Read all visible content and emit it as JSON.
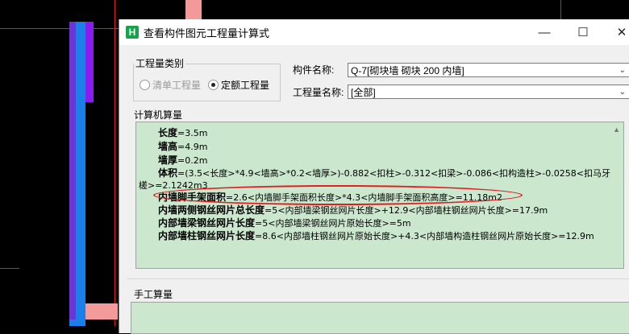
{
  "dialog": {
    "title": "查看构件图元工程量计算式",
    "app_icon_letter": "H"
  },
  "quantity_type": {
    "group_label": "工程量类别",
    "options": [
      {
        "label": "清单工程量",
        "checked": false,
        "disabled": true
      },
      {
        "label": "定额工程量",
        "checked": true,
        "disabled": false
      }
    ]
  },
  "component": {
    "name_label": "构件名称:",
    "name_value": "Q-7[砌块墙 砌块 200 内墙]",
    "qty_label": "工程量名称:",
    "qty_value": "[全部]"
  },
  "computer_calc": {
    "section_label": "计算机算量",
    "lines": [
      {
        "term": "长度",
        "formula": "=3.5m"
      },
      {
        "term": "墙高",
        "formula": "=4.9m"
      },
      {
        "term": "墙厚",
        "formula": "=0.2m"
      },
      {
        "term": "体积",
        "formula": "=(3.5<长度>*4.9<墙高>*0.2<墙厚>)-0.882<扣柱>-0.312<扣梁>-0.086<扣构造柱>-0.0258<扣马牙"
      },
      {
        "term": "",
        "formula": "槎>=2.1242m3"
      },
      {
        "term": "内墙脚手架面积",
        "formula": "=2.6<内墙脚手架面积长度>*4.3<内墙脚手架面积高度>=11.18m2"
      },
      {
        "term": "内墙两侧钢丝网片总长度",
        "formula": "=5<内部墙梁钢丝网片长度>+12.9<内部墙柱钢丝网片长度>=17.9m"
      },
      {
        "term": "内部墙梁钢丝网片长度",
        "formula": "=5<内部墙梁钢丝网片原始长度>=5m"
      },
      {
        "term": "内部墙柱钢丝网片长度",
        "formula": "=8.6<内部墙柱钢丝网片原始长度>+4.3<内部墙构造柱钢丝网片原始长度>=12.9m"
      }
    ]
  },
  "manual_calc": {
    "section_label": "手工算量"
  },
  "colors": {
    "calc_bg": "#cbe8cf",
    "highlight": "#e02020",
    "wall_blue": "#1a7fe8",
    "wall_purple": "#8a1cf0"
  }
}
